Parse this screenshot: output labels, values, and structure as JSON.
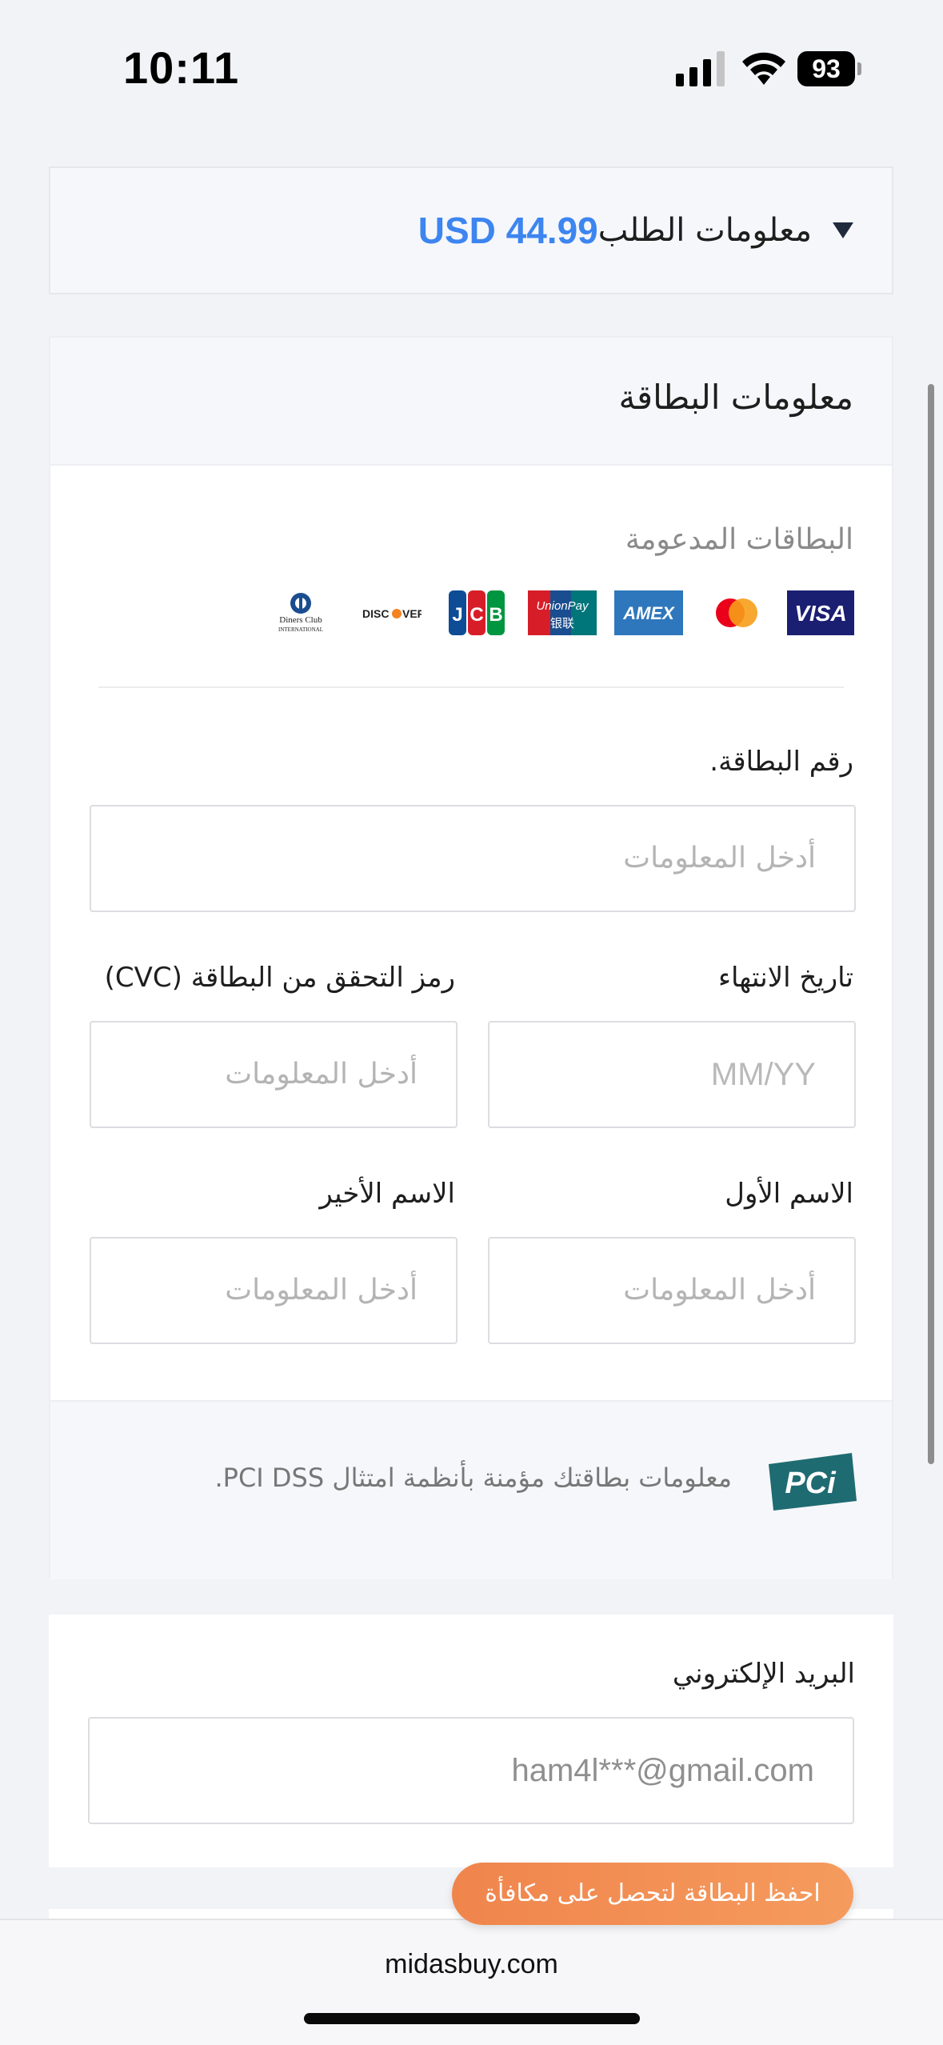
{
  "status_bar": {
    "time": "10:11",
    "battery": "93"
  },
  "order": {
    "label": "معلومات الطلب",
    "price": "USD 44.99"
  },
  "card_info": {
    "title": "معلومات البطاقة",
    "supported_label": "البطاقات المدعومة",
    "logos": [
      "VISA",
      "mastercard",
      "AMEX",
      "UnionPay",
      "JCB",
      "DISCOVER",
      "Diners Club"
    ],
    "card_number": {
      "label": "رقم البطاقة.",
      "placeholder": "أدخل المعلومات"
    },
    "expiry": {
      "label": "تاريخ الانتهاء",
      "placeholder": "MM/YY"
    },
    "cvc": {
      "label": "رمز التحقق من البطاقة (CVC)",
      "placeholder": "أدخل المعلومات"
    },
    "first_name": {
      "label": "الاسم الأول",
      "placeholder": "أدخل المعلومات"
    },
    "last_name": {
      "label": "الاسم الأخير",
      "placeholder": "أدخل المعلومات"
    },
    "pci_text": "معلومات بطاقتك مؤمنة بأنظمة امتثال PCI DSS.",
    "pci_logo": "PCi"
  },
  "email": {
    "label": "البريد الإلكتروني",
    "value": "ham4l***@gmail.com"
  },
  "save_card_button": "احفظ البطاقة لتحصل على مكافأة",
  "browser": {
    "domain": "midasbuy.com"
  },
  "colors": {
    "price": "#3d85f0",
    "pill": "#f0854c",
    "pci": "#1f6b72"
  }
}
